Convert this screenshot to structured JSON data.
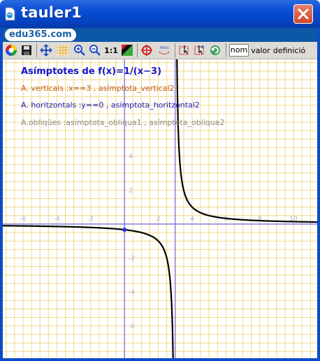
{
  "window": {
    "title": "tauler1",
    "close_icon": "close-x-icon"
  },
  "brand": {
    "logo_text": "edu365.com"
  },
  "toolbar": {
    "icons": [
      "color-wheel-icon",
      "save-disk-icon",
      "axes-move-icon",
      "grid-icon",
      "zoom-in-icon",
      "zoom-out-icon",
      "scale-1-1-icon",
      "foreground-color-icon",
      "target-icon",
      "move-mode-icon",
      "selection-icon",
      "selection-add-icon",
      "refresh-icon"
    ],
    "scale_label": "1:1",
    "label_nom": "nom",
    "label_valor": "valor",
    "label_definicio": "definició"
  },
  "board": {
    "heading": "Asímptotes de f(x)=1/(x−3)",
    "vertical_text": "A. verticals :x==3 , asímptota_vertical2",
    "horizontal_text": "A. horitzontals :y==0 , asímptota_horitzontal2",
    "oblique_text": "A.obliqües :asímptota_obliqua1 , asímptota_obliqua2",
    "colors": {
      "heading": "#1515d2",
      "vertical": "#c35a14",
      "horizontal": "#1e1ebe",
      "oblique": "#8c8c8c",
      "grid": "#f1d78c",
      "axes": "#6c6cd8",
      "tick_labels": "#b0b0d8",
      "curve": "#000000"
    }
  },
  "chart_data": {
    "type": "line",
    "function": "f(x) = 1/(x-3)",
    "xlim": [
      -7.2,
      11.4
    ],
    "ylim": [
      -7.9,
      9.7
    ],
    "x_ticks": [
      -6,
      -4,
      -2,
      2,
      4,
      6,
      8,
      10
    ],
    "y_ticks": [
      -8,
      -6,
      -4,
      -2,
      2,
      4
    ],
    "grid": true,
    "asymptotes": {
      "vertical_x": 3,
      "horizontal_y": 0
    },
    "marked_point": {
      "x": 0,
      "y": -0.333
    }
  }
}
